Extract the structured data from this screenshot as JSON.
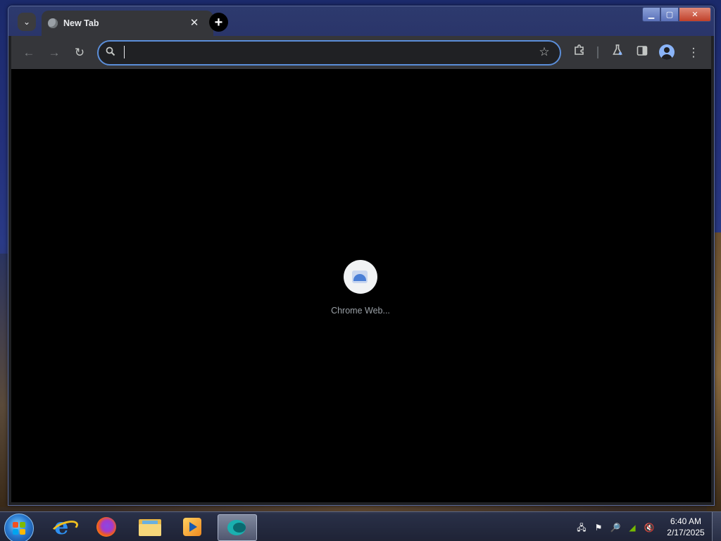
{
  "browser": {
    "tab": {
      "title": "New Tab",
      "close_glyph": "✕"
    },
    "new_tab_glyph": "+",
    "omnibox": {
      "value": "",
      "placeholder": ""
    },
    "window_controls": {
      "minimize": "▁",
      "maximize": "▢",
      "close": "✕"
    },
    "icons": {
      "tab_search": "chevron-down-icon",
      "back": "arrow-left-icon",
      "forward": "arrow-right-icon",
      "reload": "reload-icon",
      "search": "search-icon",
      "bookmark": "star-icon",
      "extensions": "puzzle-icon",
      "labs": "flask-icon",
      "side_panel": "side-panel-icon",
      "profile": "profile-avatar-icon",
      "menu": "three-dot-menu-icon"
    },
    "glyphs": {
      "tab_search": "⌄",
      "back": "←",
      "forward": "→",
      "reload": "↻",
      "search": "🔍",
      "bookmark": "☆",
      "extensions": "⧉",
      "labs": "⚗",
      "side_panel": "◧",
      "menu": "⋮"
    },
    "accent_color": "#5b8ed9"
  },
  "new_tab_page": {
    "shortcuts": [
      {
        "label": "Chrome Web..."
      }
    ]
  },
  "taskbar": {
    "apps": [
      {
        "name": "internet-explorer"
      },
      {
        "name": "firefox"
      },
      {
        "name": "file-explorer"
      },
      {
        "name": "media-player"
      },
      {
        "name": "chrome-like-app",
        "active": true
      }
    ],
    "tray": {
      "glyphs": {
        "network": "🖧",
        "action_center": "⚑",
        "search": "🔎",
        "nvidia": "◢",
        "volume": "🔇"
      }
    },
    "clock": {
      "time": "6:40 AM",
      "date": "2/17/2025"
    }
  }
}
